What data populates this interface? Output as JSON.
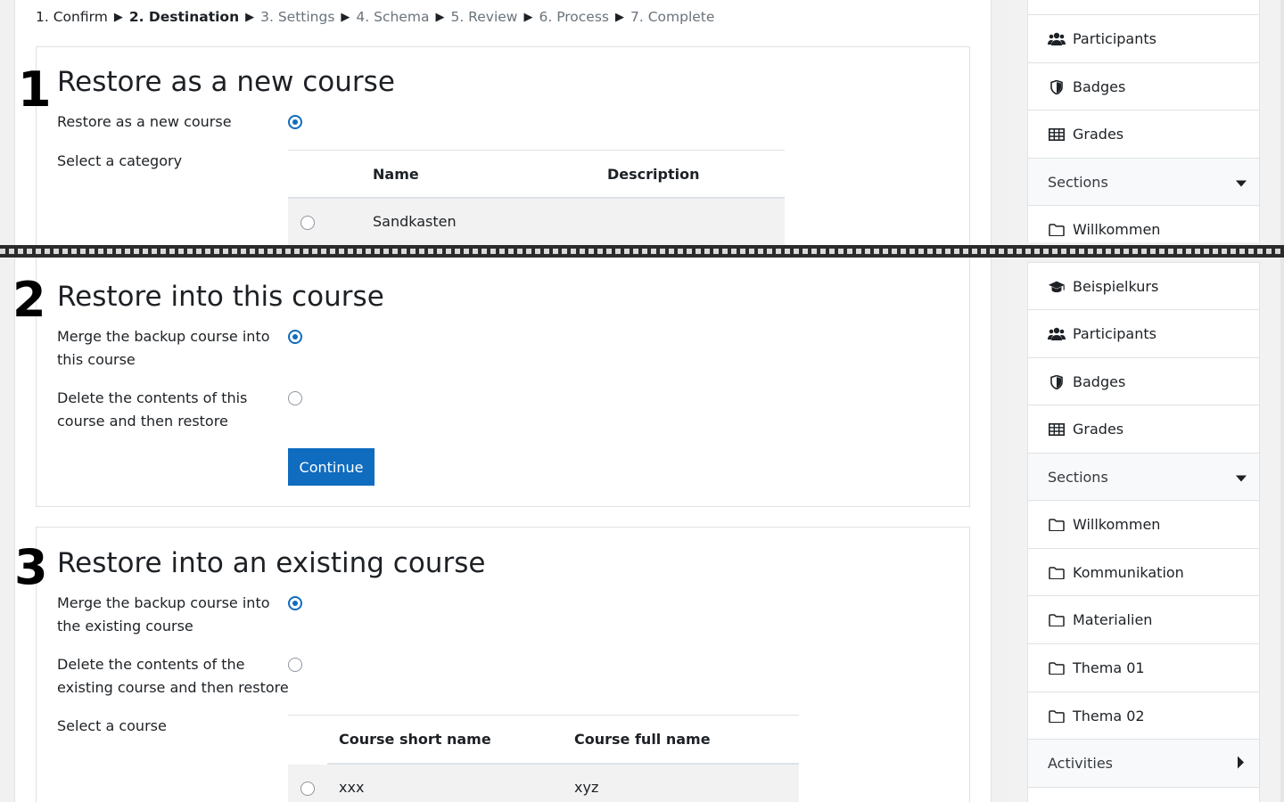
{
  "breadcrumb": {
    "steps": [
      "1. Confirm",
      "2. Destination",
      "3. Settings",
      "4. Schema",
      "5. Review",
      "6. Process",
      "7. Complete"
    ],
    "separator": "▶"
  },
  "callouts": [
    "1",
    "2",
    "3"
  ],
  "new_course": {
    "title": "Restore as a new course",
    "option_label": "Restore as a new course",
    "category_label": "Select a category",
    "table": {
      "headers": [
        "Name",
        "Description"
      ],
      "rows": [
        [
          "Sandkasten",
          ""
        ]
      ]
    }
  },
  "this_course": {
    "title": "Restore into this course",
    "merge_label": "Merge the backup course into this course",
    "delete_label": "Delete the contents of this course and then restore",
    "continue_button": "Continue"
  },
  "existing_course": {
    "title": "Restore into an existing course",
    "merge_label": "Merge the backup course into the existing course",
    "delete_label": "Delete the contents of the existing course and then restore",
    "select_label": "Select a course",
    "table": {
      "headers": [
        "Course short name",
        "Course full name"
      ],
      "rows": [
        [
          "xxx",
          "xyz"
        ]
      ]
    }
  },
  "sidebar_top": {
    "items": [
      {
        "label": "Participants",
        "icon": "users-icon"
      },
      {
        "label": "Badges",
        "icon": "shield-icon"
      },
      {
        "label": "Grades",
        "icon": "table-icon"
      },
      {
        "label": "Sections",
        "icon": "caret-down-icon"
      },
      {
        "label": "Willkommen",
        "icon": "folder-icon"
      }
    ]
  },
  "sidebar_bottom": {
    "items": [
      {
        "label": "Beispielkurs",
        "icon": "graduation-cap-icon"
      },
      {
        "label": "Participants",
        "icon": "users-icon"
      },
      {
        "label": "Badges",
        "icon": "shield-icon"
      },
      {
        "label": "Grades",
        "icon": "table-icon"
      },
      {
        "label": "Sections",
        "icon": "caret-down-icon"
      },
      {
        "label": "Willkommen",
        "icon": "folder-icon"
      },
      {
        "label": "Kommunikation",
        "icon": "folder-icon"
      },
      {
        "label": "Materialien",
        "icon": "folder-icon"
      },
      {
        "label": "Thema 01",
        "icon": "folder-icon"
      },
      {
        "label": "Thema 02",
        "icon": "folder-icon"
      },
      {
        "label": "Activities",
        "icon": "caret-right-icon"
      }
    ]
  },
  "colors": {
    "primary": "#0f6cbf",
    "text": "#1d2125",
    "muted": "#6a737b",
    "border": "#dee2e6"
  }
}
